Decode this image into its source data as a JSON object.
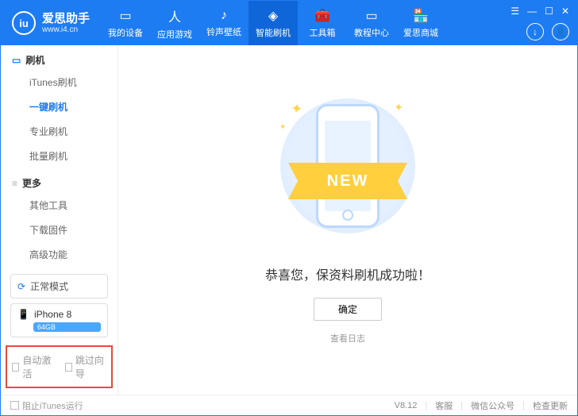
{
  "header": {
    "logo_text": "iu",
    "title": "爱思助手",
    "url": "www.i4.cn",
    "nav": [
      {
        "icon": "▭",
        "label": "我的设备"
      },
      {
        "icon": "人",
        "label": "应用游戏"
      },
      {
        "icon": "♪",
        "label": "铃声壁纸"
      },
      {
        "icon": "◈",
        "label": "智能刷机"
      },
      {
        "icon": "🧰",
        "label": "工具箱"
      },
      {
        "icon": "▭",
        "label": "教程中心"
      },
      {
        "icon": "🏪",
        "label": "爱思商城"
      }
    ],
    "win": {
      "menu": "☰",
      "min": "—",
      "max": "☐",
      "close": "✕"
    },
    "download_icon": "↓",
    "user_icon": "👤"
  },
  "sidebar": {
    "section1": {
      "title": "刷机",
      "items": [
        "iTunes刷机",
        "一键刷机",
        "专业刷机",
        "批量刷机"
      ]
    },
    "section2": {
      "title": "更多",
      "items": [
        "其他工具",
        "下载固件",
        "高级功能"
      ]
    },
    "mode_btn": {
      "icon": "⟳",
      "label": "正常模式"
    },
    "device": {
      "icon": "📱",
      "name": "iPhone 8",
      "badge": "64GB"
    },
    "checks": {
      "auto_activate": "自动激活",
      "skip_guide": "跳过向导"
    }
  },
  "main": {
    "ribbon": "NEW",
    "msg": "恭喜您，保资料刷机成功啦！",
    "ok": "确定",
    "view_log": "查看日志"
  },
  "footer": {
    "block_itunes": "阻止iTunes运行",
    "version": "V8.12",
    "support": "客服",
    "wechat": "微信公众号",
    "check_update": "检查更新"
  }
}
